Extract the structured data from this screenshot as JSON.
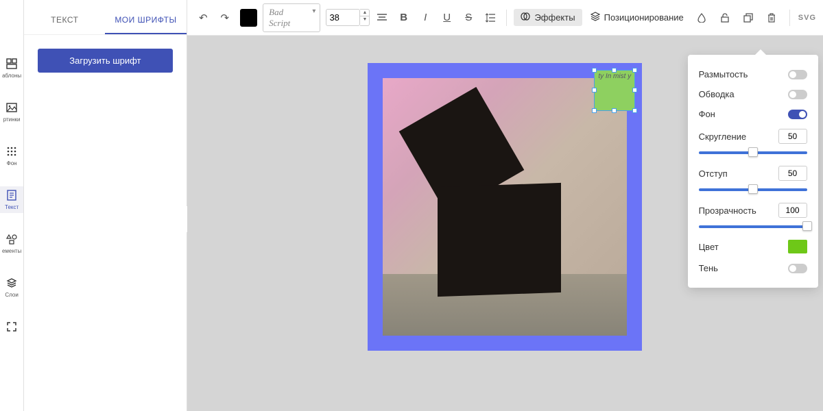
{
  "rail": {
    "items": [
      {
        "label": "аблоны",
        "icon": "templates"
      },
      {
        "label": "ртинки",
        "icon": "images"
      },
      {
        "label": "Фон",
        "icon": "background"
      },
      {
        "label": "Текст",
        "icon": "text",
        "active": true
      },
      {
        "label": "ементы",
        "icon": "elements"
      },
      {
        "label": "Слои",
        "icon": "layers"
      },
      {
        "label": "",
        "icon": "fullscreen"
      }
    ]
  },
  "sidePanel": {
    "tabs": [
      {
        "label": "ТЕКСТ",
        "active": false
      },
      {
        "label": "МОИ ШРИФТЫ",
        "active": true
      }
    ],
    "uploadButton": "Загрузить шрифт"
  },
  "toolbar": {
    "fontName": "Bad Script",
    "fontSize": "38",
    "effectsLabel": "Эффекты",
    "positionLabel": "Позиционирование",
    "svgLabel": "SVG",
    "colorValue": "#000000"
  },
  "effectsPanel": {
    "blur": {
      "label": "Размытость",
      "on": false
    },
    "stroke": {
      "label": "Обводка",
      "on": false
    },
    "background": {
      "label": "Фон",
      "on": true
    },
    "rounding": {
      "label": "Скругление",
      "value": "50",
      "sliderPct": 50
    },
    "padding": {
      "label": "Отступ",
      "value": "50",
      "sliderPct": 50
    },
    "opacity": {
      "label": "Прозрачность",
      "value": "100",
      "sliderPct": 100
    },
    "color": {
      "label": "Цвет",
      "value": "#6ec818"
    },
    "shadow": {
      "label": "Тень",
      "on": false
    }
  },
  "canvas": {
    "textContent": "ty In mist y"
  }
}
